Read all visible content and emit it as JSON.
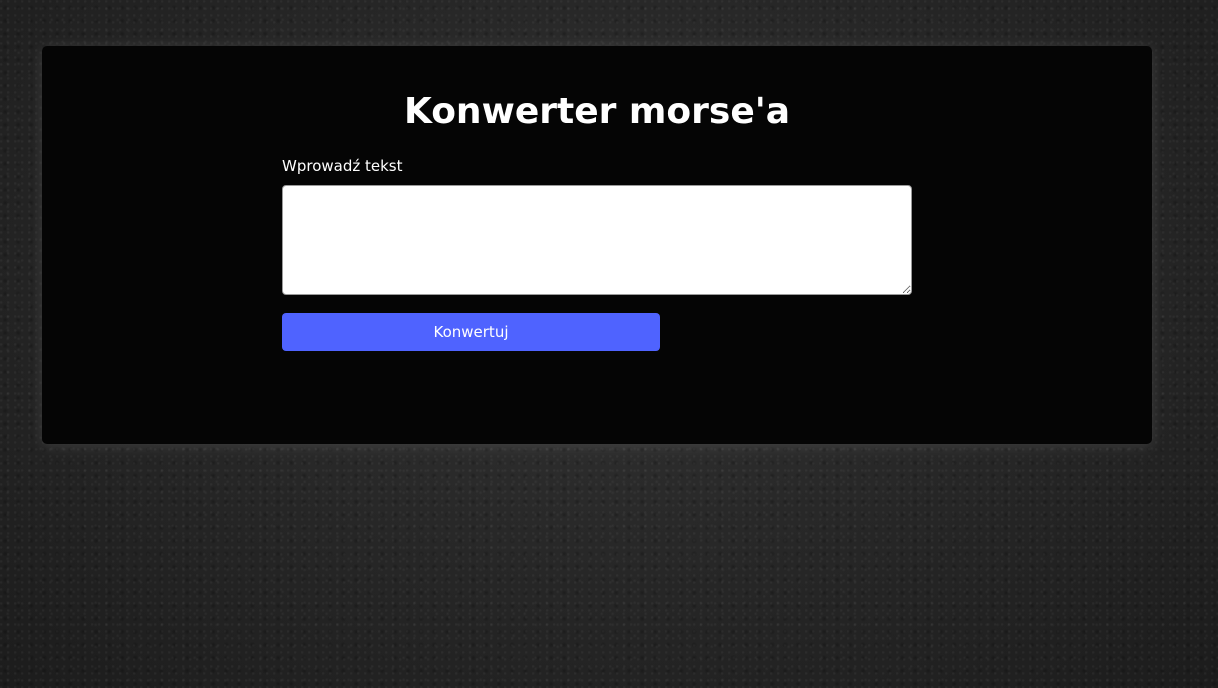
{
  "page": {
    "title": "Konwerter morse'a"
  },
  "form": {
    "input_label": "Wprowadź tekst",
    "input_value": "",
    "submit_label": "Konwertuj"
  },
  "colors": {
    "card_background": "#050505",
    "button_background": "#4f63ff",
    "page_background": "#2b2b2b"
  }
}
